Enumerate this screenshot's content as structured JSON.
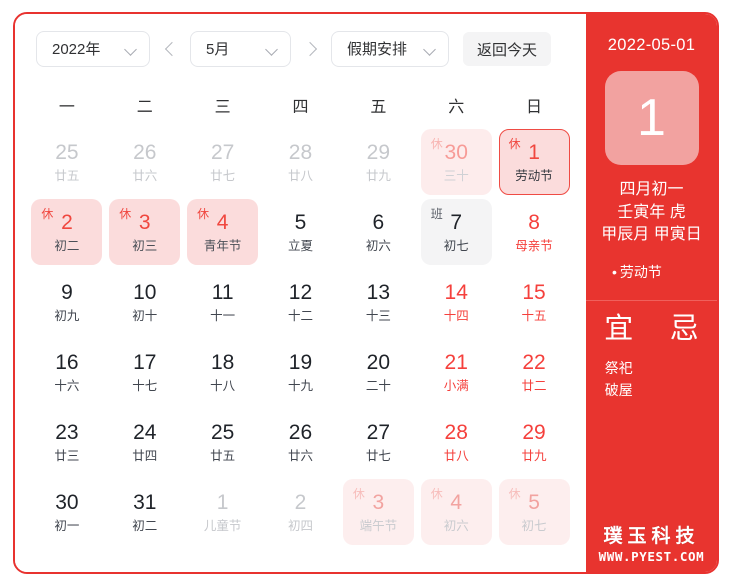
{
  "toolbar": {
    "year_select": "2022年",
    "month_select": "5月",
    "holiday_select": "假期安排",
    "today_button": "返回今天",
    "prev_icon": "chevron-left-icon",
    "next_icon": "chevron-right-icon"
  },
  "weekdays": [
    "一",
    "二",
    "三",
    "四",
    "五",
    "六",
    "日"
  ],
  "badges": {
    "rest": "休",
    "work": "班"
  },
  "days": [
    {
      "num": "25",
      "lunar": "廿五",
      "state": "other"
    },
    {
      "num": "26",
      "lunar": "廿六",
      "state": "other"
    },
    {
      "num": "27",
      "lunar": "廿七",
      "state": "other"
    },
    {
      "num": "28",
      "lunar": "廿八",
      "state": "other"
    },
    {
      "num": "29",
      "lunar": "廿九",
      "state": "other"
    },
    {
      "num": "30",
      "lunar": "三十",
      "state": "rest prev",
      "badge": "休"
    },
    {
      "num": "1",
      "lunar": "劳动节",
      "state": "selected",
      "badge": "休"
    },
    {
      "num": "2",
      "lunar": "初二",
      "state": "rest",
      "badge": "休"
    },
    {
      "num": "3",
      "lunar": "初三",
      "state": "rest",
      "badge": "休"
    },
    {
      "num": "4",
      "lunar": "青年节",
      "state": "rest",
      "badge": "休"
    },
    {
      "num": "5",
      "lunar": "立夏",
      "state": "normal"
    },
    {
      "num": "6",
      "lunar": "初六",
      "state": "normal"
    },
    {
      "num": "7",
      "lunar": "初七",
      "state": "work",
      "badge": "班"
    },
    {
      "num": "8",
      "lunar": "母亲节",
      "state": "red"
    },
    {
      "num": "9",
      "lunar": "初九",
      "state": "normal"
    },
    {
      "num": "10",
      "lunar": "初十",
      "state": "normal"
    },
    {
      "num": "11",
      "lunar": "十一",
      "state": "normal"
    },
    {
      "num": "12",
      "lunar": "十二",
      "state": "normal"
    },
    {
      "num": "13",
      "lunar": "十三",
      "state": "normal"
    },
    {
      "num": "14",
      "lunar": "十四",
      "state": "red"
    },
    {
      "num": "15",
      "lunar": "十五",
      "state": "red"
    },
    {
      "num": "16",
      "lunar": "十六",
      "state": "normal"
    },
    {
      "num": "17",
      "lunar": "十七",
      "state": "normal"
    },
    {
      "num": "18",
      "lunar": "十八",
      "state": "normal"
    },
    {
      "num": "19",
      "lunar": "十九",
      "state": "normal"
    },
    {
      "num": "20",
      "lunar": "二十",
      "state": "normal"
    },
    {
      "num": "21",
      "lunar": "小满",
      "state": "red"
    },
    {
      "num": "22",
      "lunar": "廿二",
      "state": "red"
    },
    {
      "num": "23",
      "lunar": "廿三",
      "state": "normal"
    },
    {
      "num": "24",
      "lunar": "廿四",
      "state": "normal"
    },
    {
      "num": "25",
      "lunar": "廿五",
      "state": "normal"
    },
    {
      "num": "26",
      "lunar": "廿六",
      "state": "normal"
    },
    {
      "num": "27",
      "lunar": "廿七",
      "state": "normal"
    },
    {
      "num": "28",
      "lunar": "廿八",
      "state": "red"
    },
    {
      "num": "29",
      "lunar": "廿九",
      "state": "red"
    },
    {
      "num": "30",
      "lunar": "初一",
      "state": "normal"
    },
    {
      "num": "31",
      "lunar": "初二",
      "state": "normal"
    },
    {
      "num": "1",
      "lunar": "儿童节",
      "state": "other"
    },
    {
      "num": "2",
      "lunar": "初四",
      "state": "other"
    },
    {
      "num": "3",
      "lunar": "端午节",
      "state": "rest faded",
      "badge": "休"
    },
    {
      "num": "4",
      "lunar": "初六",
      "state": "rest faded",
      "badge": "休"
    },
    {
      "num": "5",
      "lunar": "初七",
      "state": "rest faded",
      "badge": "休"
    }
  ],
  "detail": {
    "date": "2022-05-01",
    "day_number": "1",
    "lunar_day": "四月初一",
    "ganzhi_year": "壬寅年 虎",
    "ganzhi_month_day": "甲辰月 甲寅日",
    "festival": "劳动节",
    "festival_bullet": "•",
    "yi_title": "宜",
    "ji_title": "忌",
    "yi_items": [
      "祭祀",
      "破屋"
    ],
    "ji_items": []
  },
  "watermark": {
    "brand": "璞玉科技",
    "url": "WWW.PYEST.COM"
  },
  "colors": {
    "accent_red": "#e8342f",
    "rest_bg": "#fbdcdc",
    "work_bg": "#f4f4f5",
    "big_day_bg": "#f2a2a0"
  }
}
